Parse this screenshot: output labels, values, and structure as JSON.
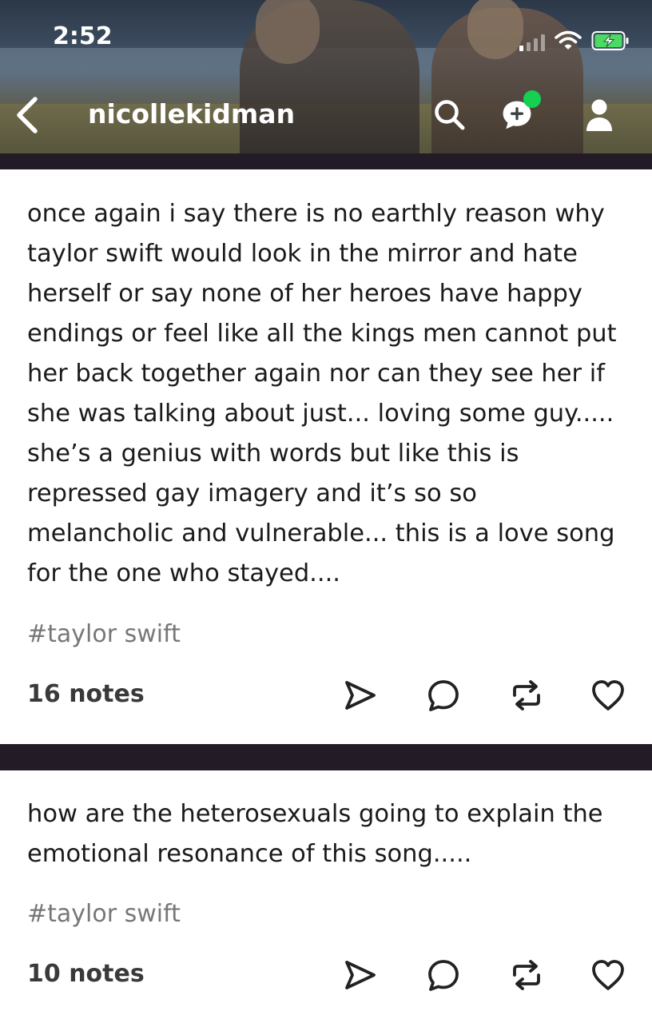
{
  "status_bar": {
    "time": "2:52",
    "signal_icon": "cellular-signal-icon",
    "wifi_icon": "wifi-icon",
    "battery_icon": "battery-charging-icon"
  },
  "header": {
    "blog_name": "nicollekidman",
    "back_icon": "chevron-left-icon",
    "search_icon": "search-icon",
    "compose_icon": "compose-icon",
    "account_icon": "account-icon",
    "badge_color": "#16d054"
  },
  "posts": [
    {
      "text": "once again i say there is no earthly reason why taylor swift would look in the mirror and hate herself or say none of her heroes have happy endings or feel like all the kings men cannot put her back together again nor can they see her if she was talking about just... loving some guy..... she’s a genius with words but like this is repressed gay imagery and it’s so so melancholic and vulnerable... this is a love song for the one who stayed....",
      "tag": "#taylor swift",
      "notes": "16 notes"
    },
    {
      "text": "how are the heterosexuals going to explain the emotional resonance of this song.....",
      "tag": "#taylor swift",
      "notes": "10 notes"
    }
  ],
  "actions": {
    "share_icon": "share-icon",
    "reply_icon": "reply-icon",
    "reblog_icon": "reblog-icon",
    "like_icon": "heart-icon"
  },
  "colors": {
    "divider": "#231b25",
    "tag_text": "#777777"
  }
}
